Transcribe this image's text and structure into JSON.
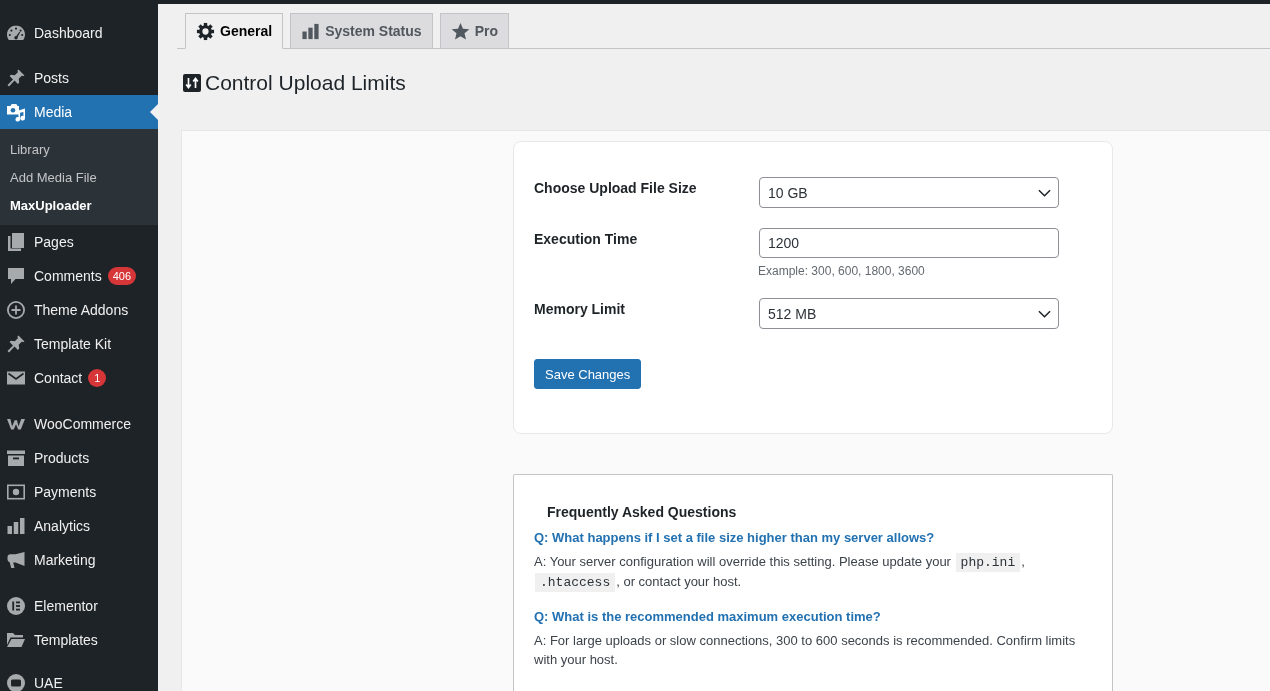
{
  "sidebar": {
    "groups": [
      {
        "items": [
          {
            "label": "Dashboard",
            "selected": false
          }
        ]
      },
      {
        "items": [
          {
            "label": "Posts",
            "selected": false
          },
          {
            "label": "Media",
            "selected": true,
            "children": [
              {
                "label": "Library",
                "selected": false
              },
              {
                "label": "Add Media File",
                "selected": false
              },
              {
                "label": "MaxUploader",
                "selected": true
              }
            ]
          },
          {
            "label": "Pages",
            "selected": false
          },
          {
            "label": "Comments",
            "selected": false,
            "badge": "406"
          },
          {
            "label": "Theme Addons",
            "selected": false
          },
          {
            "label": "Template Kit",
            "selected": false
          },
          {
            "label": "Contact",
            "selected": false,
            "badge": "1"
          }
        ]
      },
      {
        "items": [
          {
            "label": "WooCommerce",
            "selected": false
          },
          {
            "label": "Products",
            "selected": false
          },
          {
            "label": "Payments",
            "selected": false
          },
          {
            "label": "Analytics",
            "selected": false
          },
          {
            "label": "Marketing",
            "selected": false
          }
        ]
      },
      {
        "items": [
          {
            "label": "Elementor",
            "selected": false
          },
          {
            "label": "Templates",
            "selected": false
          }
        ]
      },
      {
        "items": [
          {
            "label": "UAE",
            "selected": false
          }
        ]
      }
    ]
  },
  "tabs": [
    {
      "label": "General",
      "selected": true
    },
    {
      "label": "System Status",
      "selected": false
    },
    {
      "label": "Pro",
      "selected": false
    }
  ],
  "page_title": "Control Upload Limits",
  "settings_form": {
    "fields": [
      {
        "kind": "select",
        "label": "Choose Upload File Size",
        "value": "10 GB"
      },
      {
        "kind": "text",
        "label": "Execution Time",
        "value": "1200",
        "help": "Example: 300, 600, 1800, 3600"
      },
      {
        "kind": "select",
        "label": "Memory Limit",
        "value": "512 MB"
      }
    ],
    "save_button": "Save Changes"
  },
  "faq": {
    "title": "Frequently Asked Questions",
    "items": [
      {
        "question": "Q: What happens if I set a file size higher than my server allows?",
        "answer": [
          {
            "kind": "text",
            "text": "A: Your server configuration will override this setting. Please update your "
          },
          {
            "kind": "code",
            "text": "php.ini"
          },
          {
            "kind": "text",
            "text": ", "
          },
          {
            "kind": "code",
            "text": ".htaccess"
          },
          {
            "kind": "text",
            "text": ", or contact your host."
          }
        ]
      },
      {
        "question": "Q: What is the recommended maximum execution time?",
        "answer": [
          {
            "kind": "text",
            "text": "A: For large uploads or slow connections, 300 to 600 seconds is recommended. Confirm limits with your host."
          }
        ]
      }
    ]
  }
}
